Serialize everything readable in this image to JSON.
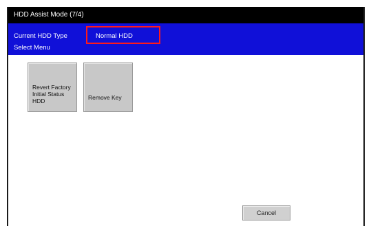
{
  "window": {
    "title": "HDD Assist Mode (7/4)"
  },
  "info": {
    "current_type_label": "Current HDD Type",
    "current_type_value": "Normal HDD",
    "select_menu_label": "Select Menu"
  },
  "menu": {
    "buttons": [
      {
        "label": "Revert Factory Initial Status HDD"
      },
      {
        "label": "Remove Key"
      }
    ]
  },
  "footer": {
    "cancel_label": "Cancel"
  },
  "colors": {
    "titlebar": "#000000",
    "infobar": "#1010d8",
    "highlight": "#ff1a1a",
    "button": "#c8c8c8"
  }
}
